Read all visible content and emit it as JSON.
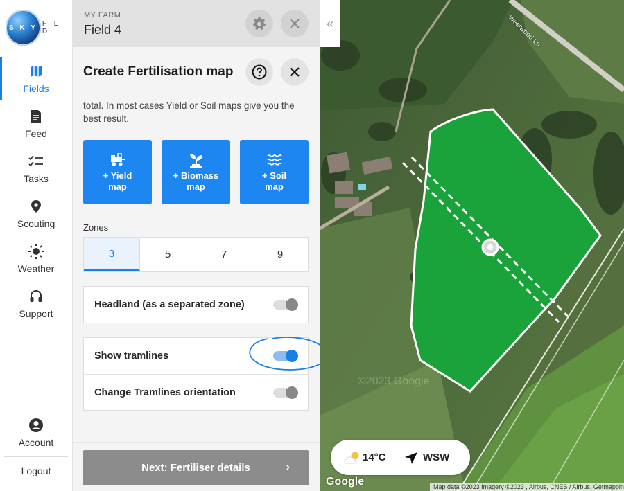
{
  "logo": {
    "globe_text": "S K Y",
    "brand_suffix": "F L D"
  },
  "nav": {
    "items": [
      {
        "label": "Fields",
        "icon": "map-icon",
        "active": true
      },
      {
        "label": "Feed",
        "icon": "document-icon"
      },
      {
        "label": "Tasks",
        "icon": "checklist-icon"
      },
      {
        "label": "Scouting",
        "icon": "location-pin-icon"
      },
      {
        "label": "Weather",
        "icon": "sun-icon"
      },
      {
        "label": "Support",
        "icon": "headphones-icon"
      }
    ],
    "account_label": "Account",
    "logout_label": "Logout"
  },
  "header": {
    "farm_label": "MY FARM",
    "field_name": "Field 4"
  },
  "panel": {
    "title": "Create Fertilisation map",
    "description": "total. In most cases Yield or Soil maps give you the best result.",
    "tiles": [
      {
        "label_line1": "+ Yield",
        "label_line2": "map",
        "icon": "harvester-icon"
      },
      {
        "label_line1": "+ Biomass",
        "label_line2": "map",
        "icon": "plant-icon"
      },
      {
        "label_line1": "+ Soil",
        "label_line2": "map",
        "icon": "waves-icon"
      }
    ],
    "zones_label": "Zones",
    "zones": [
      "3",
      "5",
      "7",
      "9"
    ],
    "selected_zone": "3",
    "headland_label": "Headland (as a separated zone)",
    "headland_on": false,
    "tramlines_label": "Show tramlines",
    "tramlines_on": true,
    "orientation_label": "Change Tramlines orientation",
    "orientation_on": false,
    "next_label": "Next: Fertiliser details"
  },
  "map": {
    "road_label": "Westwood Ln",
    "collapse_glyph": "«",
    "weather": {
      "temperature": "14°C",
      "wind": "WSW"
    },
    "google_label": "Google",
    "credit": "Map data ©2023 Imagery ©2023 , Airbus, CNES / Airbus, Getmapping plc",
    "watermark": "©2023 Google"
  },
  "colors": {
    "accent": "#1c7fe6",
    "tile": "#1e86f0",
    "field_fill": "#1aa33a"
  }
}
